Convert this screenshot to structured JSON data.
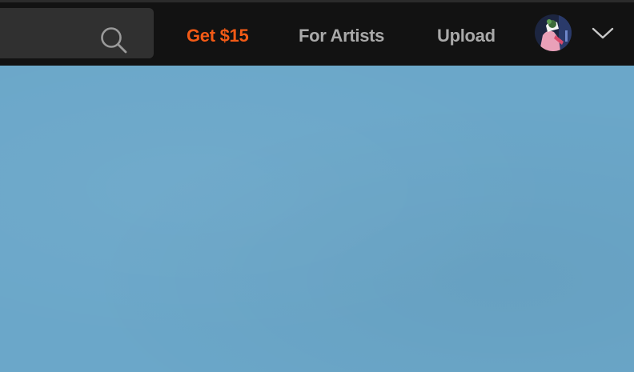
{
  "nav": {
    "promo_label": "Get $15",
    "for_artists_label": "For Artists",
    "upload_label": "Upload"
  },
  "icons": {
    "search": "search-icon",
    "avatar": "user-avatar",
    "menu": "chevron-down-icon"
  },
  "colors": {
    "navbar_bg": "#121212",
    "search_bg": "#303030",
    "promo": "#f25a16",
    "nav_text": "#a9a9a9",
    "hero_bg": "#6ba7c9"
  }
}
